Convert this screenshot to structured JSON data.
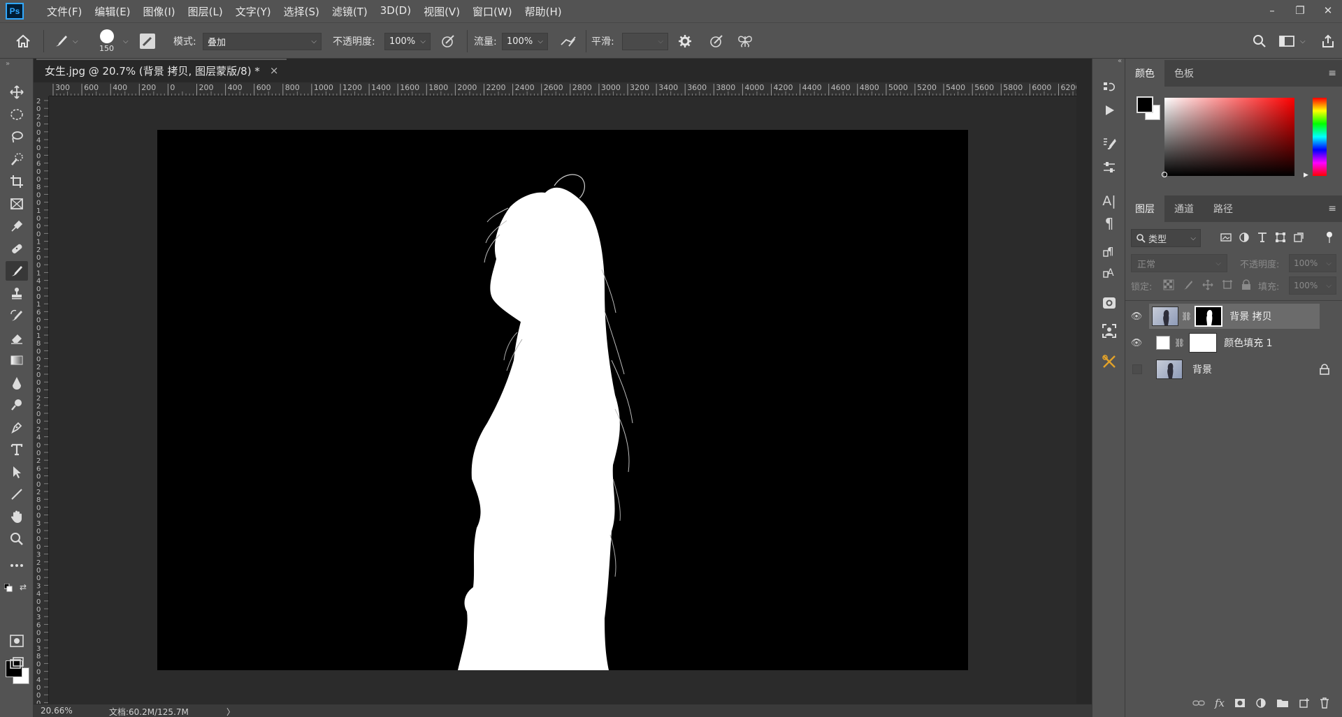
{
  "app": {
    "logo_text": "Ps"
  },
  "menu": [
    "文件(F)",
    "编辑(E)",
    "图像(I)",
    "图层(L)",
    "文字(Y)",
    "选择(S)",
    "滤镜(T)",
    "3D(D)",
    "视图(V)",
    "窗口(W)",
    "帮助(H)"
  ],
  "window_controls": {
    "minimize": "–",
    "restore": "❐",
    "close": "✕"
  },
  "options": {
    "brush_size": "150",
    "mode_label": "模式:",
    "mode_value": "叠加",
    "opacity_label": "不透明度:",
    "opacity_value": "100%",
    "flow_label": "流量:",
    "flow_value": "100%",
    "smooth_label": "平滑:",
    "smooth_value": ""
  },
  "document": {
    "tab_title": "女生.jpg @ 20.7% (背景 拷贝, 图层蒙版/8) *",
    "close": "×"
  },
  "ruler": {
    "h_ticks": [
      "300",
      "600",
      "400",
      "200",
      "0",
      "200",
      "400",
      "600",
      "800",
      "1000",
      "1200",
      "1400",
      "1600",
      "1800",
      "2000",
      "2200",
      "2400",
      "2600",
      "2800",
      "3000",
      "3200",
      "3400",
      "3600",
      "3800",
      "4000",
      "4200",
      "4400",
      "4600",
      "4800",
      "5000",
      "5200",
      "5400",
      "5600",
      "5800",
      "6000",
      "6200"
    ],
    "v_ticks": [
      "2",
      "0",
      "2",
      "0",
      "0",
      "4",
      "0",
      "0",
      "6",
      "0",
      "0",
      "8",
      "0",
      "0",
      "1",
      "0",
      "0",
      "0",
      "1",
      "2",
      "0",
      "0",
      "1",
      "4",
      "0",
      "0",
      "1",
      "6",
      "0",
      "0",
      "1",
      "8",
      "0",
      "0",
      "2",
      "0",
      "0",
      "0",
      "2",
      "2",
      "0",
      "0",
      "2",
      "4",
      "0",
      "0",
      "2",
      "6",
      "0",
      "0",
      "2",
      "8",
      "0",
      "0",
      "3",
      "0",
      "0",
      "0",
      "3",
      "2",
      "0",
      "0",
      "3",
      "4",
      "0",
      "0",
      "3",
      "6",
      "0",
      "0",
      "3",
      "8",
      "0",
      "0",
      "4",
      "0",
      "0",
      "0"
    ]
  },
  "status": {
    "zoom": "20.66%",
    "doc_info": "文档:60.2M/125.7M",
    "arrow": "〉"
  },
  "color_panel": {
    "tabs": [
      "颜色",
      "色板"
    ],
    "foreground": "#000000",
    "background": "#ffffff",
    "hue": "#ff0000"
  },
  "layers_panel": {
    "tabs": [
      "图层",
      "通道",
      "路径"
    ],
    "filter_label": "类型",
    "blend_mode": "正常",
    "opacity_label": "不透明度:",
    "opacity_value": "100%",
    "lock_label": "锁定:",
    "fill_label": "填充:",
    "fill_value": "100%",
    "layers": [
      {
        "name": "背景 拷贝",
        "visible": true,
        "selected": true
      },
      {
        "name": "颜色填充 1",
        "visible": true,
        "selected": false
      },
      {
        "name": "背景",
        "visible": false,
        "selected": false,
        "locked": true
      }
    ],
    "footer_fx": "fx"
  },
  "colors": {
    "app_bg": "#535353",
    "canvas_bg": "#282828",
    "accent": "#31a8ff"
  }
}
